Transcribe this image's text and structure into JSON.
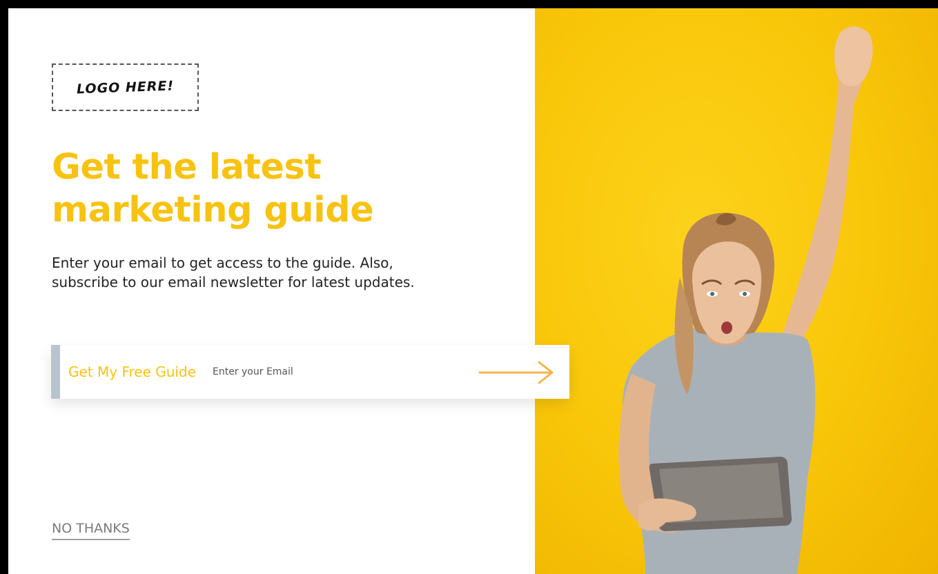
{
  "logo": {
    "text": "LOGO HERE!"
  },
  "headline": {
    "line1": "Get the latest",
    "line2": "marketing guide"
  },
  "subtext": {
    "line1": "Enter your email to get access to the guide. Also,",
    "line2": "subscribe to our email newsletter for latest updates."
  },
  "form": {
    "label": "Get My Free Guide",
    "email_placeholder": "Enter your Email",
    "email_value": ""
  },
  "no_thanks": "NO THANKS",
  "photo": {
    "subject": "excited-woman-with-tablet-photo"
  },
  "icons": {
    "submit": "arrow-right-icon"
  },
  "colors": {
    "accent": "#f7c312",
    "photo_background": "#f9c70a",
    "form_accent_bar": "#b9c3cd",
    "arrow": "#f4b548"
  }
}
